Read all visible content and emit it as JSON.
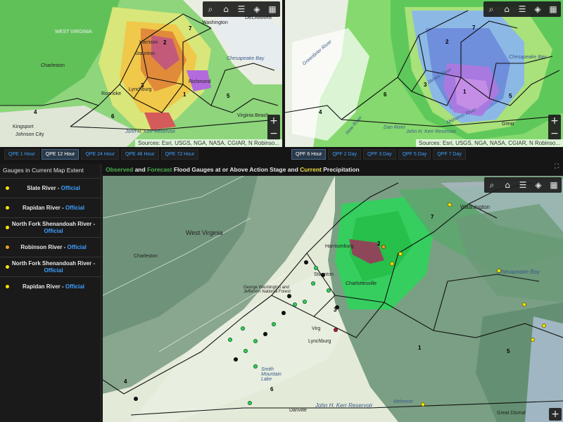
{
  "maps": {
    "qpe": {
      "attribution": "Sources: Esri, USGS, NGA, NASA, CGIAR, N Robinso...",
      "tabs": [
        "QPE 1 Hour",
        "QPE 12 Hour",
        "QPE 24 Hour",
        "QPE 48 Hour",
        "QPE 72 Hour"
      ],
      "active_tab": "QPE 12 Hour",
      "labels": {
        "west_virginia": "WEST VIRGINIA",
        "charleston": "Charleston",
        "harrisonburg": "Harrison",
        "staunton": "Staunton",
        "lynchburg": "Lynchburg",
        "roanoke": "Roanoke",
        "richmond": "Richmond",
        "washington": "Washington",
        "delaware": "DELAWARE",
        "chesapeake_bay": "Chesapeake Bay",
        "virginia_beach": "Virginia Beach",
        "kingsport": "Kingsport",
        "johnson_city": "Johnson City",
        "kerr_reservoir": "John H. Kerr Reservoir"
      },
      "region_numbers": [
        "1",
        "2",
        "3",
        "4",
        "5",
        "6",
        "7"
      ]
    },
    "qpf": {
      "attribution": "Sources: Esri, USGS, NGA, NASA, CGIAR, N Robinso...",
      "tabs": [
        "QPF 6 Hour",
        "QPF 2 Day",
        "QPF 3 Day",
        "QPF 5 Day",
        "QPF 7 Day"
      ],
      "active_tab": "QPF 6 Hour",
      "labels": {
        "chesapeake_bay": "Chesapeake Bay",
        "james_river": "James River",
        "new_river": "New River",
        "dan_river": "Dan River",
        "kerr_reservoir": "John H. Kerr Reservoir",
        "greenbrier": "Greenbrier River",
        "meherrin": "Meherrin River",
        "great": "Great"
      },
      "region_numbers": [
        "1",
        "2",
        "3",
        "4",
        "5",
        "6",
        "7"
      ]
    },
    "main": {
      "labels": {
        "west_virginia": "West Virginia",
        "charleston": "Charleston",
        "harrisonburg": "Harrisonburg",
        "staunton": "Staunton",
        "lynchburg": "Lynchburg",
        "charlottesville": "Charlottesville",
        "washington": "Washington",
        "chesapeake_bay": "Chesapeake Bay",
        "smith_mountain_lake": "Smith Mountain Lake",
        "kerr_reservoir": "John H. Kerr Reservoir",
        "george_washington": "George Washington and Jefferson National Forest",
        "danville": "Danville",
        "virginia": "Virg",
        "meherrin": "Meherrin",
        "great_dismal": "Great Dismal"
      },
      "region_numbers": [
        "1",
        "2",
        "3",
        "4",
        "5",
        "6",
        "7"
      ]
    }
  },
  "sidebar": {
    "title": "Gauges in Current Map Extent",
    "official_label": "Official",
    "gauges": [
      {
        "name": "Slate River",
        "color": "#f5e50a"
      },
      {
        "name": "Rapidan River",
        "color": "#f5e50a"
      },
      {
        "name": "North Fork Shenandoah River",
        "color": "#f5e50a"
      },
      {
        "name": "Robinson River",
        "color": "#f0a020"
      },
      {
        "name": "North Fork Shenandoah River",
        "color": "#f5e50a"
      },
      {
        "name": "Rapidan River",
        "color": "#f5e50a"
      }
    ]
  },
  "heading": {
    "observed": "Observed",
    "and": " and ",
    "forecast": "Forecast",
    "middle": " Flood Gauges at or Above Action Stage and ",
    "current": "Current",
    "end": " Precipitation"
  },
  "toolbar_icons": [
    "search-icon",
    "home-icon",
    "list-icon",
    "layers-icon",
    "basemap-icon"
  ],
  "colors": {
    "accent": "#3ea0ff",
    "observed": "#4caf50",
    "current": "#f0e04a"
  }
}
